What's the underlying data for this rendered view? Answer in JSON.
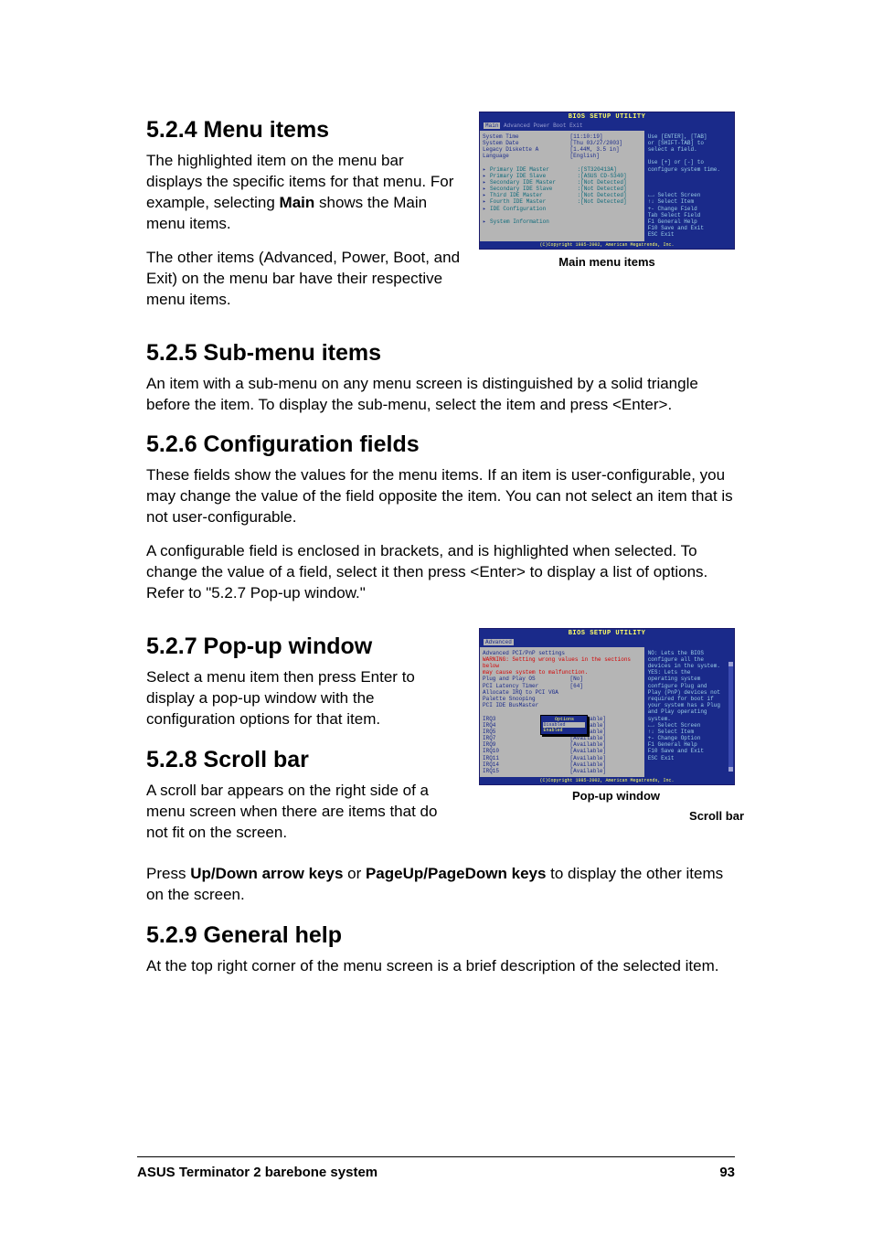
{
  "sections": {
    "s524": {
      "title": "5.2.4  Menu items",
      "p1_a": "The highlighted item on the menu bar displays the specific items for that menu. For example, selecting ",
      "p1_b": "Main",
      "p1_c": " shows the Main menu items.",
      "p2": "The other items (Advanced, Power, Boot, and Exit) on the menu bar have their respective menu items."
    },
    "s525": {
      "title": "5.2.5  Sub-menu items",
      "p1": "An item with a sub-menu on any menu screen is distinguished by a solid triangle before the item. To display the sub-menu, select the item and press <Enter>."
    },
    "s526": {
      "title": "5.2.6  Configuration fields",
      "p1": "These fields show the values for the menu items. If an item is user-configurable, you may change the value of the field opposite the item. You can not select an item that is not user-configurable.",
      "p2": "A configurable field is enclosed in brackets, and is highlighted when selected. To change the value of a field, select it then press <Enter> to display a list of options. Refer to \"5.2.7 Pop-up window.\""
    },
    "s527": {
      "title": "5.2.7  Pop-up window",
      "p1": "Select a menu item then press Enter to display a pop-up window with the configuration options for that item."
    },
    "s528": {
      "title": "5.2.8  Scroll bar",
      "p1": "A scroll bar appears on the right side of a menu screen when there are items that do not fit on the screen.",
      "p2_a": "Press ",
      "p2_b": "Up/Down arrow keys",
      "p2_c": " or ",
      "p2_d": "PageUp/PageDown keys",
      "p2_e": " to display the other items on the screen."
    },
    "s529": {
      "title": "5.2.9  General help",
      "p1": "At the top right corner of the menu screen is a brief description of the selected item."
    }
  },
  "bios1": {
    "title": "BIOS SETUP UTILITY",
    "menubar": [
      "Main",
      "Advanced",
      "Power",
      "Boot",
      "Exit"
    ],
    "left": [
      {
        "k": "System Time",
        "v": "[11:10:19]"
      },
      {
        "k": "System Date",
        "v": "[Thu 03/27/2003]"
      },
      {
        "k": "Legacy Diskette A",
        "v": "[1.44M, 3.5 in]"
      },
      {
        "k": "Language",
        "v": "[English]"
      },
      {
        "k": "",
        "v": ""
      },
      {
        "k": "Primary IDE Master",
        "v": ":[ST320413A]",
        "tri": true
      },
      {
        "k": "Primary IDE Slave",
        "v": ":[ASUS CD-S340]",
        "tri": true
      },
      {
        "k": "Secondary IDE Master",
        "v": ":[Not Detected]",
        "tri": true
      },
      {
        "k": "Secondary IDE Slave",
        "v": ":[Not Detected]",
        "tri": true
      },
      {
        "k": "Third IDE Master",
        "v": ":[Not Detected]",
        "tri": true
      },
      {
        "k": "Fourth IDE Master",
        "v": ":[Not Detected]",
        "tri": true
      },
      {
        "k": "IDE Configuration",
        "v": "",
        "tri": true
      },
      {
        "k": "",
        "v": ""
      },
      {
        "k": "System Information",
        "v": "",
        "tri": true
      }
    ],
    "right_top": [
      "Use [ENTER], [TAB]",
      "or [SHIFT-TAB] to",
      "select a field.",
      "",
      "Use [+] or [-] to",
      "configure system time."
    ],
    "right_bot": [
      "←→   Select Screen",
      "↑↓   Select Item",
      "+-   Change Field",
      "Tab  Select Field",
      "F1   General Help",
      "F10  Save and Exit",
      "ESC  Exit"
    ],
    "footer": "(C)Copyright 1985-2002, American Megatrends, Inc.",
    "caption": "Main menu items"
  },
  "bios2": {
    "title": "BIOS SETUP UTILITY",
    "menubar_sel": "Advanced",
    "header": "Advanced PCI/PnP settings",
    "warn1": "WARNING: Setting wrong values in the sections below",
    "warn2": "         may cause system to malfunction.",
    "left": [
      {
        "k": "Plug and Play OS",
        "v": "[No]"
      },
      {
        "k": "PCI Latency Timer",
        "v": "[64]"
      },
      {
        "k": "Allocate IRQ to PCI VGA",
        "v": ""
      },
      {
        "k": "Palette Snooping",
        "v": "Disabled"
      },
      {
        "k": "PCI IDE BusMaster",
        "v": "Enabled"
      },
      {
        "k": "",
        "v": ""
      },
      {
        "k": "IRQ3",
        "v": "[Available]"
      },
      {
        "k": "IRQ4",
        "v": "[Available]"
      },
      {
        "k": "IRQ5",
        "v": "[Available]"
      },
      {
        "k": "IRQ7",
        "v": "[Available]"
      },
      {
        "k": "IRQ9",
        "v": "[Available]"
      },
      {
        "k": "IRQ10",
        "v": "[Available]"
      },
      {
        "k": "IRQ11",
        "v": "[Available]"
      },
      {
        "k": "IRQ14",
        "v": "[Available]"
      },
      {
        "k": "IRQ15",
        "v": "[Available]"
      }
    ],
    "popup": {
      "title": "Options",
      "opts": [
        "Disabled",
        "Enabled"
      ]
    },
    "right_top": [
      "NO: Lets the BIOS",
      "configure all the",
      "devices in the system.",
      "YES: Lets the",
      "operating system",
      "configure Plug and",
      "Play (PnP) devices not",
      "required for boot if",
      "your system has a Plug",
      "and Play operating",
      "system."
    ],
    "right_bot": [
      "←→   Select Screen",
      "↑↓   Select Item",
      "+-   Change Option",
      "F1   General Help",
      "F10  Save and Exit",
      "ESC  Exit"
    ],
    "footer": "(C)Copyright 1985-2002, American Megatrends, Inc.",
    "caption_popup": "Pop-up window",
    "caption_scroll": "Scroll bar"
  },
  "footer": {
    "left": "ASUS Terminator 2 barebone system",
    "right": "93"
  }
}
